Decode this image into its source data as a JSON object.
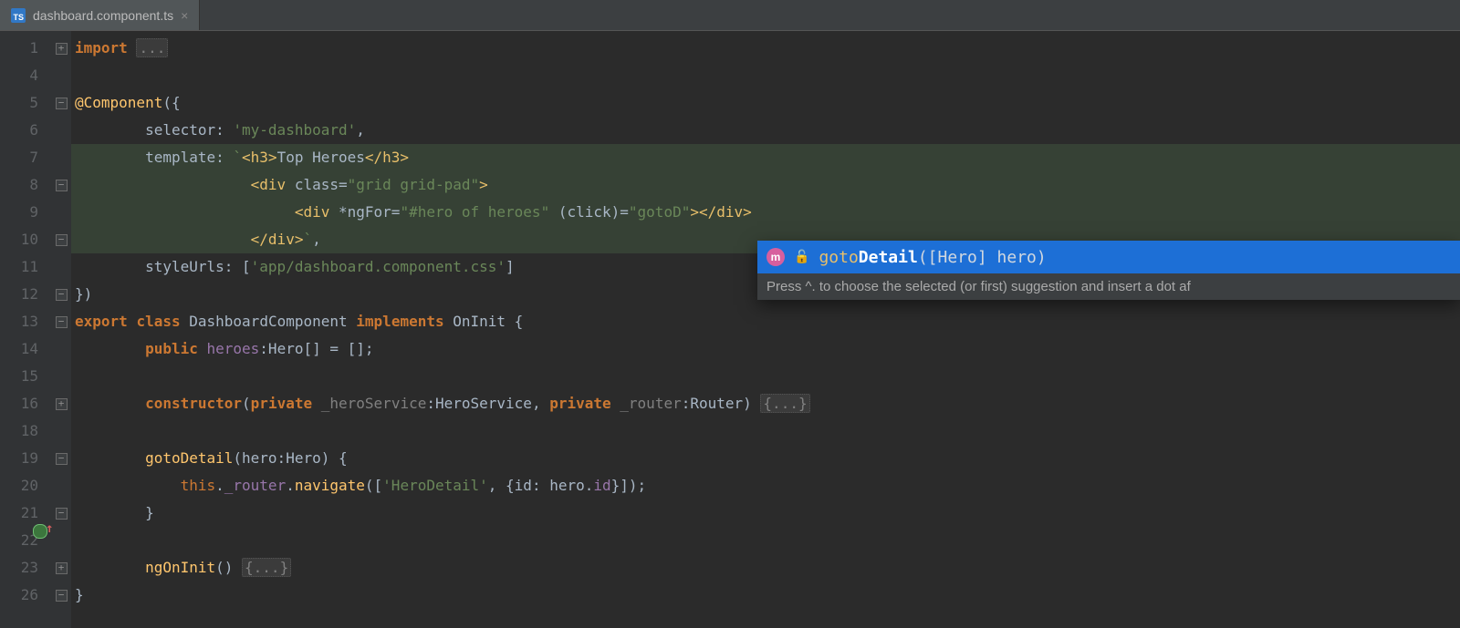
{
  "tab": {
    "filename": "dashboard.component.ts"
  },
  "gutter_lines": [
    "1",
    "4",
    "5",
    "6",
    "7",
    "8",
    "9",
    "10",
    "11",
    "12",
    "13",
    "14",
    "15",
    "16",
    "18",
    "19",
    "20",
    "21",
    "22",
    "23",
    "26"
  ],
  "code_lines": [
    {
      "kind": "import",
      "kw": "import",
      "rest": " ",
      "folded": "..."
    },
    {
      "kind": "blank"
    },
    {
      "kind": "decorator",
      "t1": "@",
      "t2": "Component",
      "t3": "({"
    },
    {
      "kind": "selector",
      "indent": "        ",
      "key": "selector: ",
      "str": "'my-dashboard'",
      "punct": ","
    },
    {
      "kind": "template",
      "indent": "        ",
      "key": "template: ",
      "tick": "`",
      "h3o": "<h3>",
      "txt": "Top Heroes",
      "h3c": "</h3>"
    },
    {
      "kind": "tpl-div1",
      "indent": "                    ",
      "tag": "<div ",
      "attr": "class=",
      "val": "\"grid grid-pad\"",
      "close": ">"
    },
    {
      "kind": "tpl-div2",
      "indent": "                         ",
      "tag": "<div ",
      "attr1": "*ngFor=",
      "val1": "\"#hero of heroes\"",
      "sp": " ",
      "attr2": "(click)=",
      "val2": "\"gotoD\"",
      "close": "></div>"
    },
    {
      "kind": "tpl-end",
      "indent": "                    ",
      "tag": "</div>",
      "tick": "`",
      "punct": ","
    },
    {
      "kind": "styleurls",
      "indent": "        ",
      "key": "styleUrls: [",
      "str": "'app/dashboard.component.css'",
      "punct": "]"
    },
    {
      "kind": "decorator-end",
      "t": "})"
    },
    {
      "kind": "class",
      "kw1": "export",
      "sp1": " ",
      "kw2": "class",
      "sp2": " ",
      "name": "DashboardComponent ",
      "kw3": "implements",
      "sp3": " ",
      "iface": "OnInit {"
    },
    {
      "kind": "field",
      "indent": "        ",
      "kw": "public",
      "sp": " ",
      "name": "heroes",
      "type": ":Hero[] = [];"
    },
    {
      "kind": "blank"
    },
    {
      "kind": "ctor",
      "indent": "        ",
      "kw": "constructor",
      "open": "(",
      "kw2": "private",
      "sp": " ",
      "p1": "_heroService",
      "t1": ":HeroService, ",
      "kw3": "private",
      "sp2": " ",
      "p2": "_router",
      "t2": ":Router) ",
      "folded": "{...}"
    },
    {
      "kind": "blank"
    },
    {
      "kind": "method",
      "indent": "        ",
      "name": "gotoDetail",
      "sig": "(hero:Hero) {"
    },
    {
      "kind": "nav",
      "indent": "            ",
      "this": "this",
      "dot": ".",
      "fld": "_router",
      "dot2": ".",
      "m": "navigate",
      "open": "([",
      "str": "'HeroDetail'",
      "mid": ", {",
      "k": "id",
      "c": ": hero.",
      "k2": "id",
      "end": "}]);"
    },
    {
      "kind": "close",
      "indent": "        ",
      "t": "}"
    },
    {
      "kind": "blank"
    },
    {
      "kind": "method2",
      "indent": "        ",
      "name": "ngOnInit",
      "sig": "() ",
      "folded": "{...}"
    },
    {
      "kind": "close",
      "t": "}"
    }
  ],
  "popup": {
    "badge": "m",
    "prefix": "goto",
    "bold": "Detail",
    "params": "([Hero] hero)",
    "hint": "Press ^. to choose the selected (or first) suggestion and insert a dot af"
  },
  "fold_marks": [
    "+",
    "",
    "-",
    "",
    "",
    "-",
    "",
    "-",
    "",
    "-",
    "-",
    "",
    "",
    "+",
    "",
    "-",
    "",
    "-",
    "",
    "+",
    "-"
  ]
}
